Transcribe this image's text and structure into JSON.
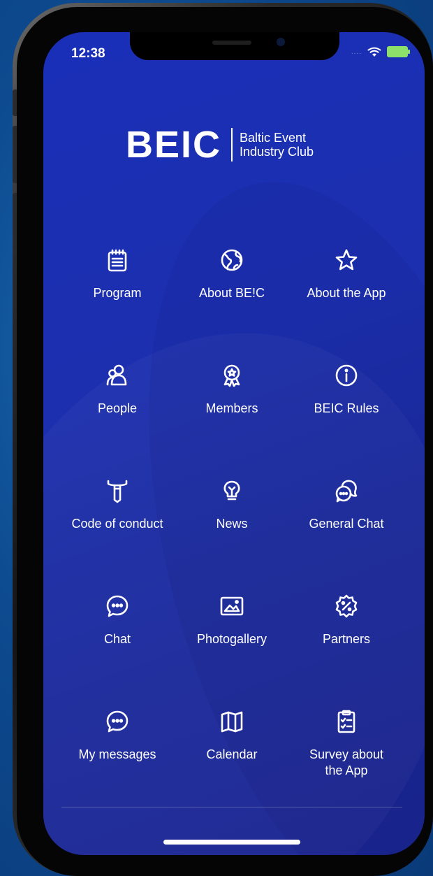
{
  "status_bar": {
    "time": "12:38",
    "signal": "....",
    "wifi_icon": "wifi-icon",
    "battery_icon": "battery-charging-icon",
    "battery_color": "#8de06a"
  },
  "logo": {
    "mark": "BEIC",
    "line1": "Baltic Event",
    "line2": "Industry Club"
  },
  "menu": [
    {
      "label": "Program",
      "icon": "calendar-notepad-icon"
    },
    {
      "label": "About BE!C",
      "icon": "globe-icon"
    },
    {
      "label": "About the App",
      "icon": "star-icon"
    },
    {
      "label": "People",
      "icon": "people-icon"
    },
    {
      "label": "Members",
      "icon": "award-badge-icon"
    },
    {
      "label": "BEIC Rules",
      "icon": "info-icon"
    },
    {
      "label": "Code of conduct",
      "icon": "tie-icon"
    },
    {
      "label": "News",
      "icon": "lightbulb-icon"
    },
    {
      "label": "General Chat",
      "icon": "group-chat-icon"
    },
    {
      "label": "Chat",
      "icon": "chat-bubble-icon"
    },
    {
      "label": "Photogallery",
      "icon": "photo-icon"
    },
    {
      "label": "Partners",
      "icon": "discount-badge-icon"
    },
    {
      "label": "My messages",
      "icon": "message-bubble-icon"
    },
    {
      "label": "Calendar",
      "icon": "map-icon"
    },
    {
      "label": "Survey about the App",
      "icon": "checklist-icon"
    }
  ],
  "colors": {
    "screen_bg": "#1a2fb8",
    "background": "#0d4a8f",
    "text": "#ffffff"
  }
}
